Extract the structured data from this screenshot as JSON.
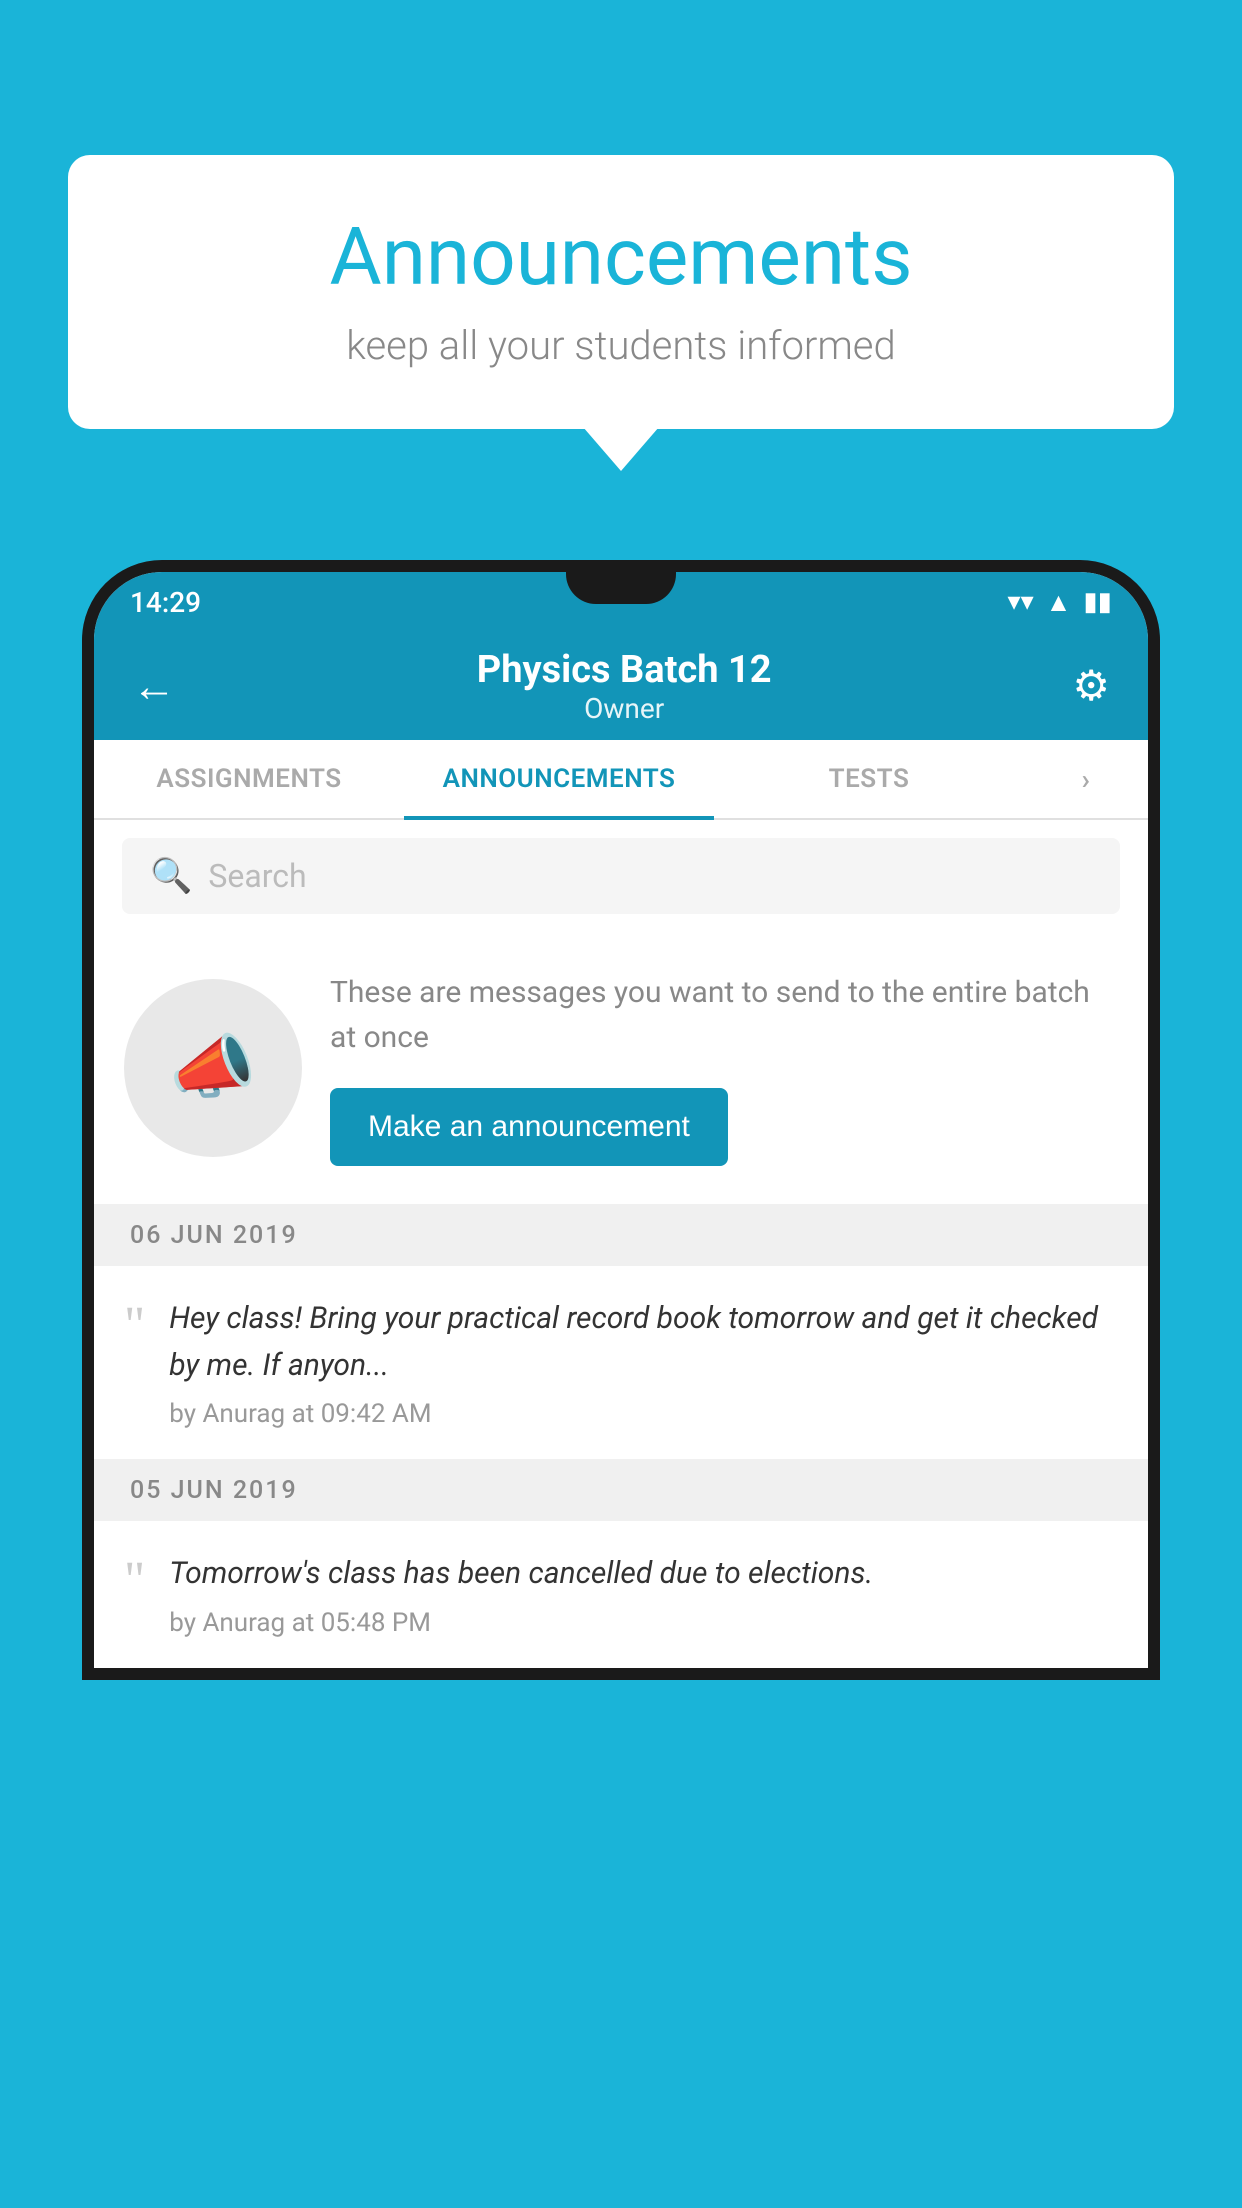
{
  "background_color": "#1ab4d8",
  "speech_bubble": {
    "title": "Announcements",
    "subtitle": "keep all your students informed"
  },
  "status_bar": {
    "time": "14:29",
    "wifi": "▼",
    "signal": "◀",
    "battery": "▮"
  },
  "header": {
    "title": "Physics Batch 12",
    "subtitle": "Owner",
    "back_label": "←",
    "settings_label": "⚙"
  },
  "tabs": [
    {
      "label": "ASSIGNMENTS",
      "active": false
    },
    {
      "label": "ANNOUNCEMENTS",
      "active": true
    },
    {
      "label": "TESTS",
      "active": false
    },
    {
      "label": "›",
      "active": false
    }
  ],
  "search": {
    "placeholder": "Search"
  },
  "promo": {
    "text": "These are messages you want to send to the entire batch at once",
    "button_label": "Make an announcement"
  },
  "announcements": [
    {
      "date": "06  JUN  2019",
      "text": "Hey class! Bring your practical record book tomorrow and get it checked by me. If anyon...",
      "meta": "by Anurag at 09:42 AM"
    },
    {
      "date": "05  JUN  2019",
      "text": "Tomorrow's class has been cancelled due to elections.",
      "meta": "by Anurag at 05:48 PM"
    }
  ]
}
